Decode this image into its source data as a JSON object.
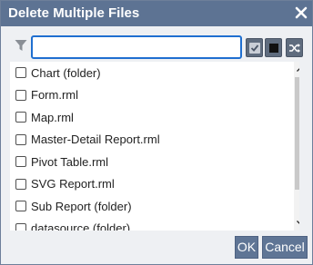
{
  "dialog": {
    "title": "Delete Multiple Files",
    "close_icon": "close-icon"
  },
  "filter": {
    "icon": "filter-icon",
    "value": "",
    "placeholder": ""
  },
  "toolbar": {
    "select_all_icon": "checkmark-icon",
    "deselect_all_icon": "square-icon",
    "invert_icon": "shuffle-icon"
  },
  "files": [
    {
      "label": "Chart (folder)",
      "checked": false
    },
    {
      "label": "Form.rml",
      "checked": false
    },
    {
      "label": "Map.rml",
      "checked": false
    },
    {
      "label": "Master-Detail Report.rml",
      "checked": false
    },
    {
      "label": "Pivot Table.rml",
      "checked": false
    },
    {
      "label": "SVG Report.rml",
      "checked": false
    },
    {
      "label": "Sub Report (folder)",
      "checked": false
    },
    {
      "label": "datasource (folder)",
      "checked": false
    }
  ],
  "buttons": {
    "ok": "OK",
    "cancel": "Cancel"
  },
  "colors": {
    "titlebar": "#5d7393",
    "button": "#5f7595",
    "input_focus": "#1f6fd0"
  }
}
